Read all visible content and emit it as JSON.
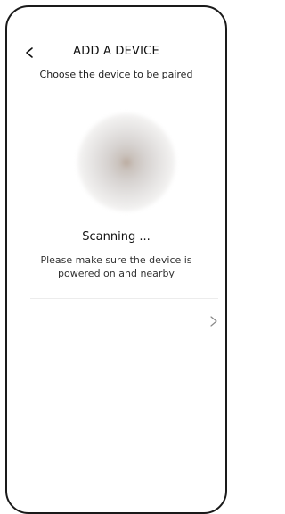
{
  "header": {
    "title": "ADD A DEVICE",
    "subtitle": "Choose the device to be paired",
    "back_icon": "chevron-left-icon"
  },
  "scan": {
    "status": "Scanning ...",
    "hint": "Please make sure the device is powered on and nearby"
  },
  "list": {
    "row_icon": "chevron-right-icon"
  },
  "colors": {
    "text_primary": "#111111",
    "border": "#1a1a1a",
    "scan_glow_center": "#b9a89b",
    "divider": "#ececec"
  }
}
